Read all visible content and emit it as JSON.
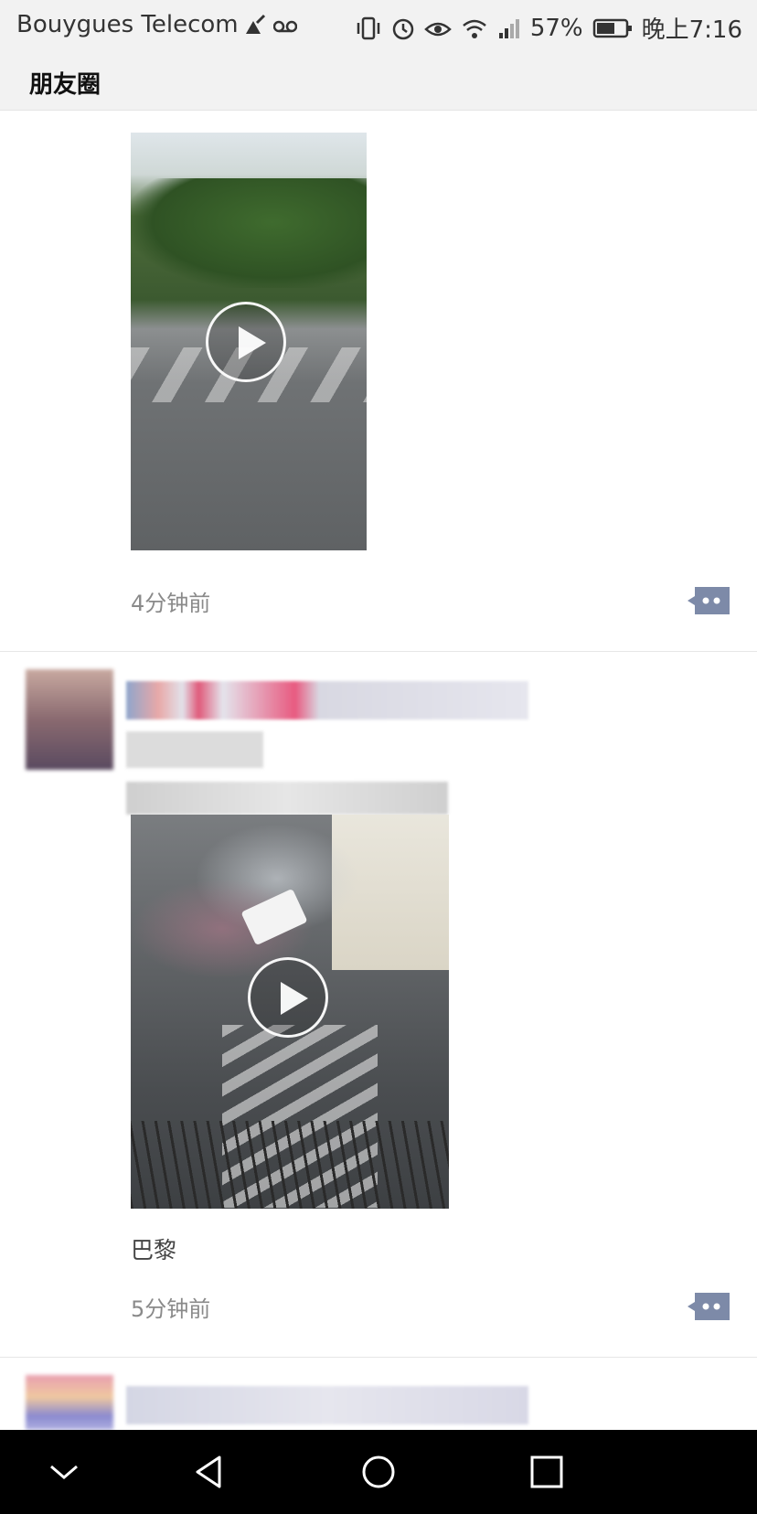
{
  "status_bar": {
    "carrier": "Bouygues Telecom",
    "battery": "57%",
    "time": "晚上7:16"
  },
  "header": {
    "title": "朋友圈"
  },
  "posts": [
    {
      "time": "4分钟前"
    },
    {
      "caption": "巴黎",
      "time": "5分钟前"
    }
  ],
  "colors": {
    "link_blue": "#576b95",
    "comment_btn": "#7d8aa8"
  },
  "icons": [
    "vibrate-icon",
    "alarm-icon",
    "eye-icon",
    "wifi-icon",
    "signal-icon",
    "battery-icon",
    "play-icon",
    "comment-icon",
    "back-icon",
    "home-icon",
    "recents-icon",
    "collapse-icon"
  ]
}
